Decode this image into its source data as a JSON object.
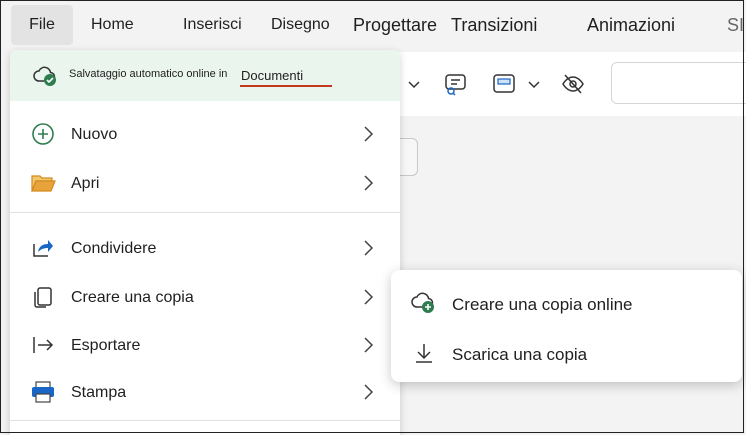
{
  "ribbon": {
    "tabs": [
      {
        "label": "File"
      },
      {
        "label": "Home"
      },
      {
        "label": "Inserisci"
      },
      {
        "label": "Disegno"
      },
      {
        "label": "Progettare"
      },
      {
        "label": "Transizioni"
      },
      {
        "label": "Animazioni"
      },
      {
        "label": "SI"
      }
    ]
  },
  "file_menu": {
    "autosave": {
      "text": "Salvataggio automatico online in",
      "location": "Documenti",
      "icon": "cloud-check-icon"
    },
    "items": [
      {
        "label": "Nuovo",
        "icon": "plus-circle-icon"
      },
      {
        "label": "Apri",
        "icon": "folder-open-icon"
      },
      {
        "label": "Condividere",
        "icon": "share-icon"
      },
      {
        "label": "Creare una copia",
        "icon": "copy-icon"
      },
      {
        "label": "Esportare",
        "icon": "export-icon"
      },
      {
        "label": "Stampa",
        "icon": "printer-icon"
      }
    ]
  },
  "submenu": {
    "items": [
      {
        "label": "Creare una copia online",
        "icon": "cloud-add-icon"
      },
      {
        "label": "Scarica una copia",
        "icon": "download-icon"
      }
    ]
  },
  "colors": {
    "accent_green": "#2e7d4f",
    "autosave_bg": "#eaf5ee",
    "underline_red": "#c4391d",
    "folder_orange": "#e8a33a",
    "share_blue": "#1a66c7"
  }
}
